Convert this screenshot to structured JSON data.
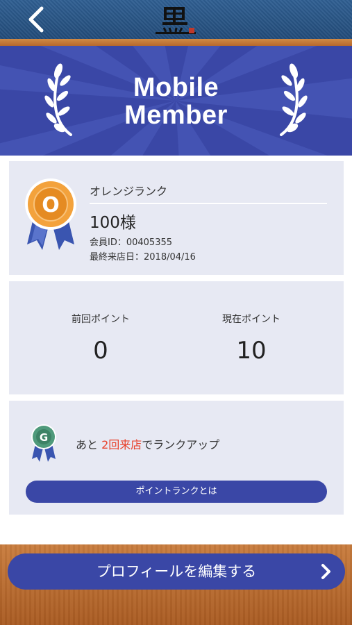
{
  "header": {
    "logo_name": "brand-logo"
  },
  "banner": {
    "title_line1": "Mobile",
    "title_line2": "Member",
    "bg_color": "#3a47a6"
  },
  "member": {
    "medal_letter": "O",
    "rank_name": "オレンジランク",
    "name": "100様",
    "member_id": "会員ID：00405355",
    "last_visit": "最終来店日：2018/04/16"
  },
  "points": {
    "previous_label": "前回ポイント",
    "previous_value": "0",
    "current_label": "現在ポイント",
    "current_value": "10"
  },
  "rankup": {
    "next_medal_letter": "G",
    "text_prefix": "あと ",
    "highlight": "2回来店",
    "text_suffix": "でランクアップ",
    "highlight_color": "#e8402a",
    "info_button": "ポイントランクとは"
  },
  "footer": {
    "profile_button": "プロフィールを編集する"
  },
  "colors": {
    "accent": "#3a47a6",
    "card_bg": "#e7e9f3",
    "wood": "#b7692c",
    "denim": "#2f5f92"
  }
}
